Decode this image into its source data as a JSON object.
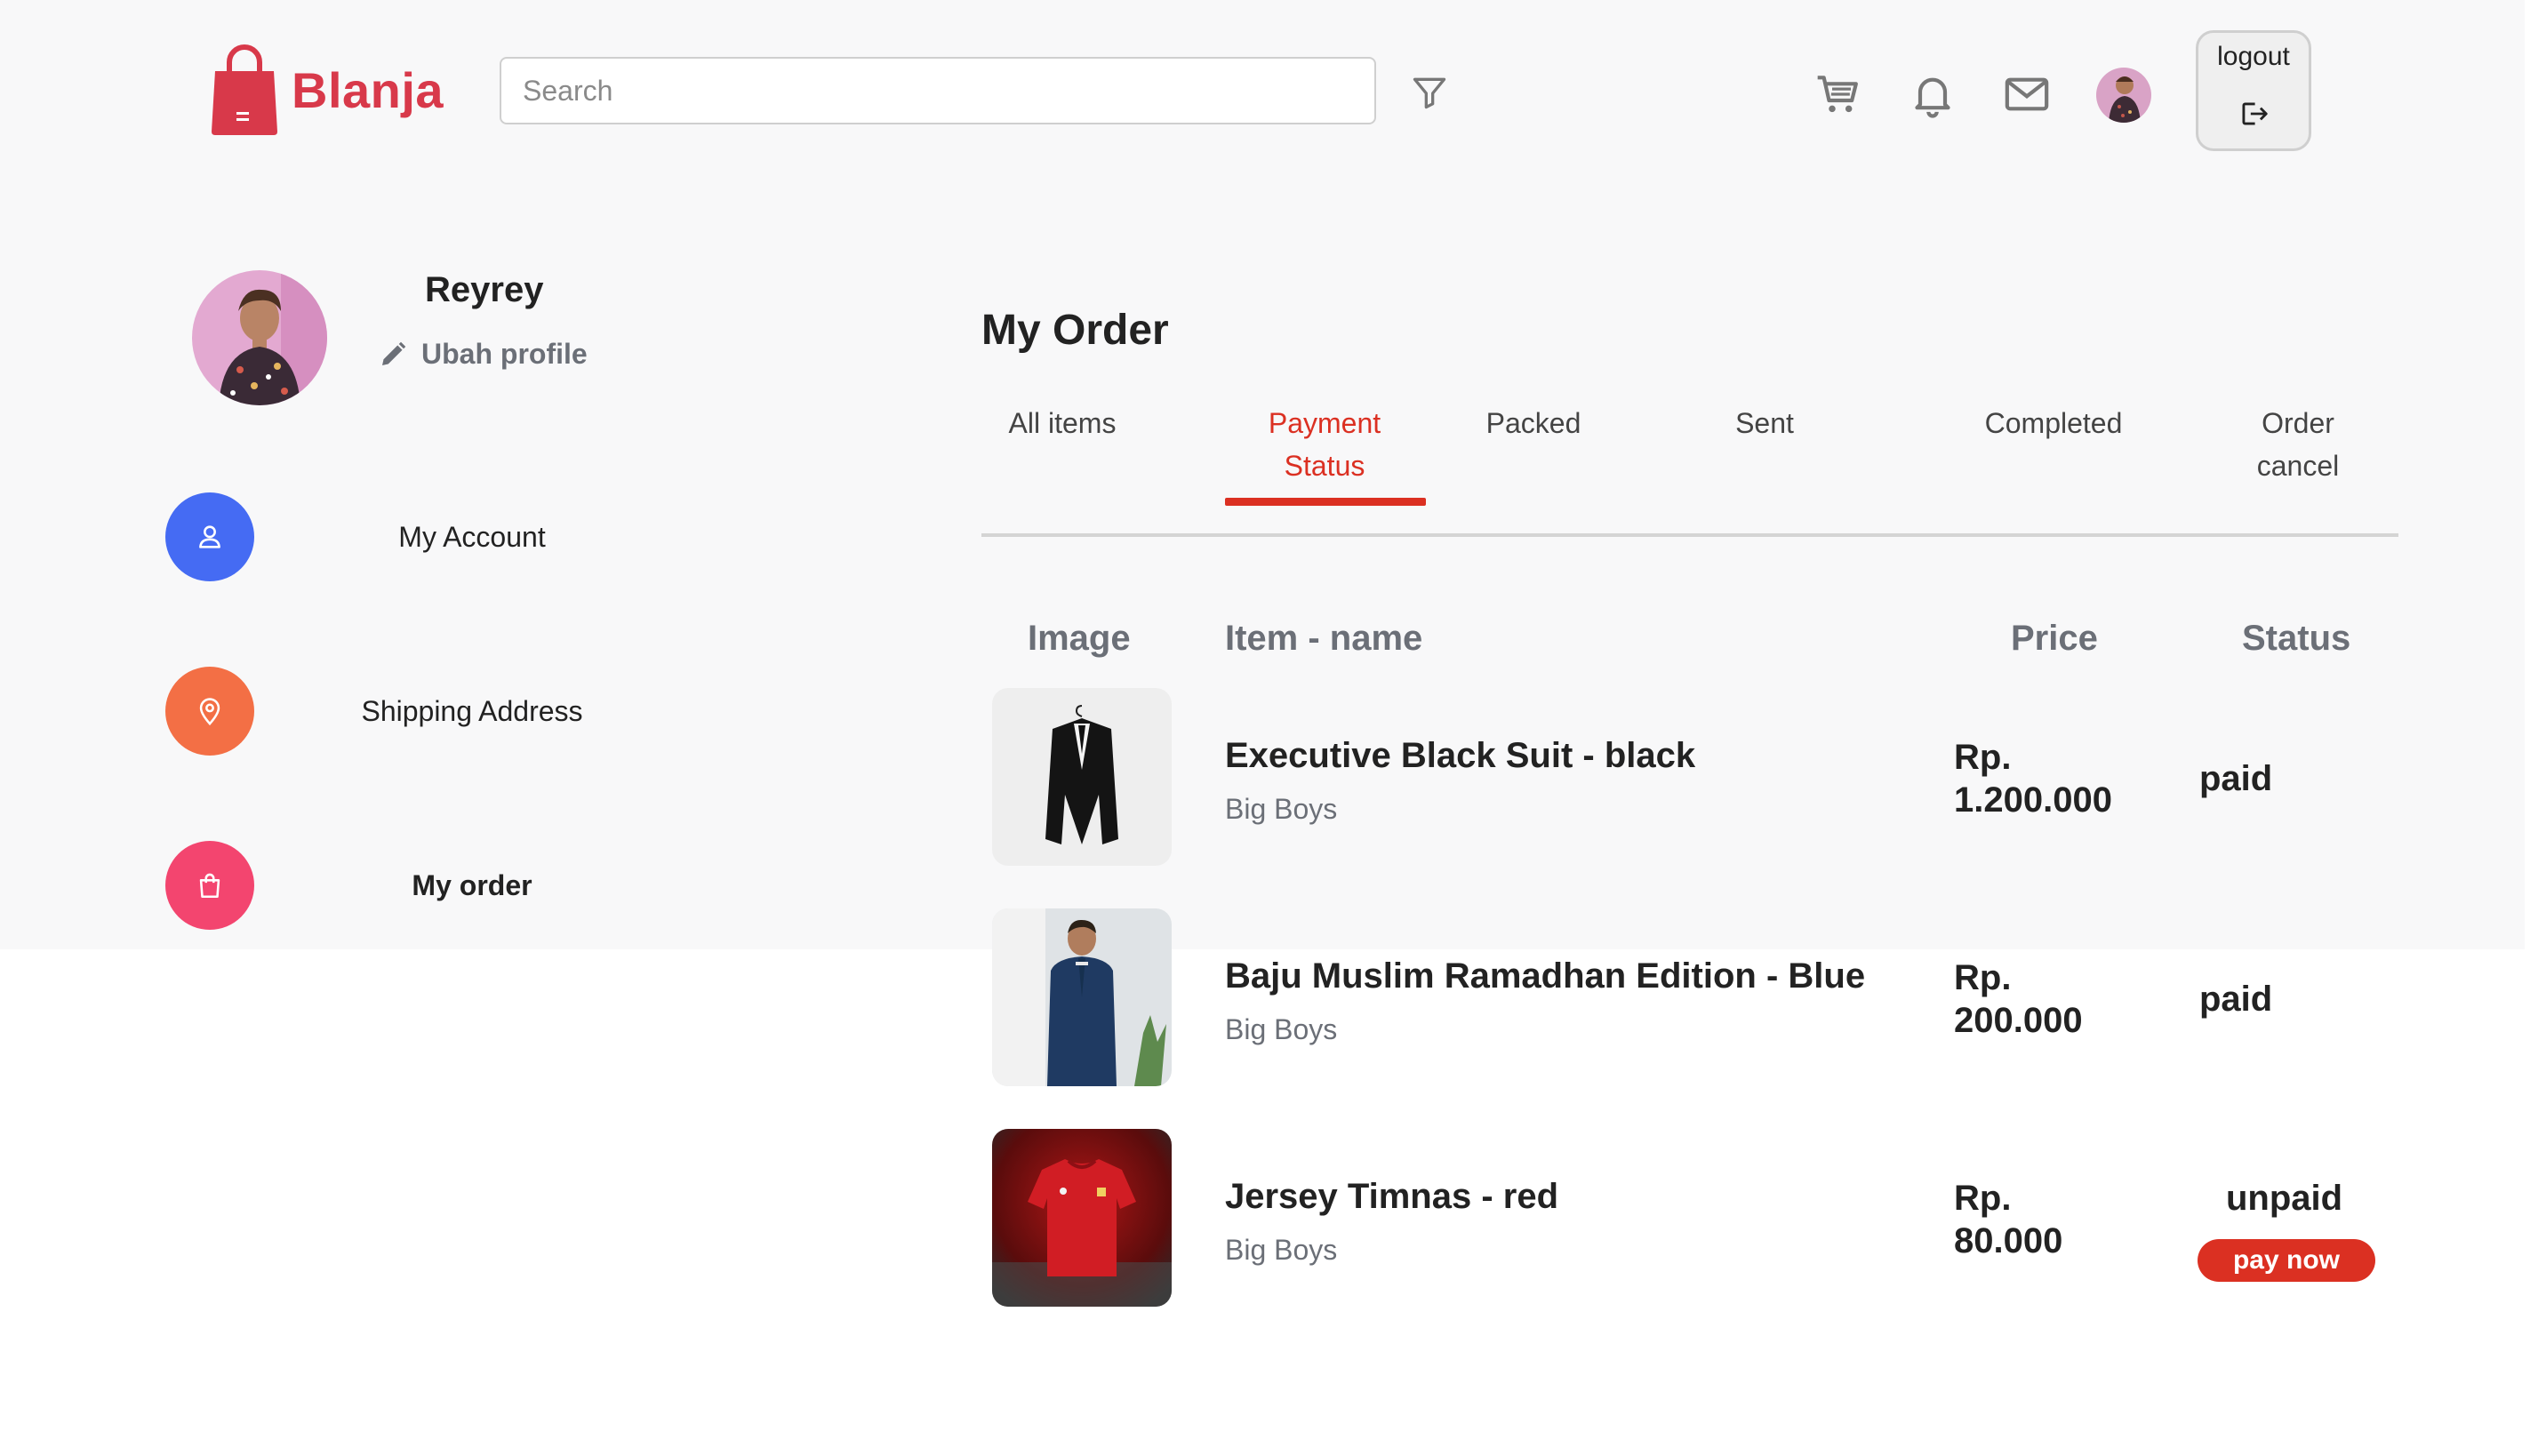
{
  "brand": {
    "name": "Blanja",
    "color": "#d8394a"
  },
  "header": {
    "search_placeholder": "Search",
    "icons": [
      "filter-icon",
      "cart-icon",
      "bell-icon",
      "mail-icon"
    ],
    "logout_label": "logout"
  },
  "profile": {
    "name": "Reyrey",
    "edit_label": "Ubah profile"
  },
  "sidebar": {
    "items": [
      {
        "label": "My Account",
        "icon": "user-icon",
        "color": "#456bf3",
        "active": false
      },
      {
        "label": "Shipping Address",
        "icon": "map-pin-icon",
        "color": "#f36f45",
        "active": false
      },
      {
        "label": "My order",
        "icon": "shopping-bag-icon",
        "color": "#f3456f",
        "active": true
      }
    ]
  },
  "main": {
    "title": "My Order",
    "tabs": [
      {
        "label": "All items"
      },
      {
        "label": "Payment Status",
        "line1": "Payment",
        "line2": "Status",
        "active": true
      },
      {
        "label": "Packed"
      },
      {
        "label": "Sent"
      },
      {
        "label": "Completed"
      },
      {
        "label": "Order cancel",
        "line1": "Order",
        "line2": "cancel"
      }
    ],
    "columns": {
      "image": "Image",
      "item_name": "Item - name",
      "price": "Price",
      "status": "Status"
    },
    "orders": [
      {
        "name": "Executive Black Suit - black",
        "seller": "Big Boys",
        "price_prefix": "Rp.",
        "price": "1.200.000",
        "status": "paid",
        "image": "black-suit-photo"
      },
      {
        "name": "Baju Muslim Ramadhan Edition - Blue",
        "seller": "Big Boys",
        "price_prefix": "Rp.",
        "price": "200.000",
        "status": "paid",
        "image": "blue-muslim-shirt-photo"
      },
      {
        "name": "Jersey Timnas - red",
        "seller": "Big Boys",
        "price_prefix": "Rp.",
        "price": "80.000",
        "status": "unpaid",
        "image": "red-jersey-photo",
        "action_label": "pay now"
      }
    ],
    "accent_color": "#db3022"
  }
}
